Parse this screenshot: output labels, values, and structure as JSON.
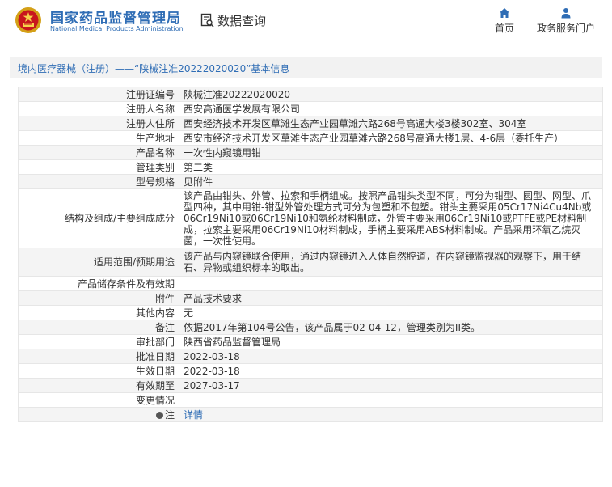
{
  "header": {
    "brand_cn": "国家药品监督管理局",
    "brand_en": "National Medical Products Administration",
    "data_query": "数据查询",
    "nav": [
      {
        "label": "首页",
        "icon": "home-icon"
      },
      {
        "label": "政务服务门户",
        "icon": "user-icon"
      }
    ]
  },
  "section": {
    "title": "境内医疗器械（注册）——“陕械注准20222020020”基本信息"
  },
  "rows": [
    {
      "label": "注册证编号",
      "value": "陕械注准20222020020"
    },
    {
      "label": "注册人名称",
      "value": "西安高通医学发展有限公司"
    },
    {
      "label": "注册人住所",
      "value": "西安经济技术开发区草滩生态产业园草滩六路268号高通大楼3楼302室、304室"
    },
    {
      "label": "生产地址",
      "value": "西安市经济技术开发区草滩生态产业园草滩六路268号高通大楼1层、4-6层（委托生产）"
    },
    {
      "label": "产品名称",
      "value": "一次性内窥镜用钳"
    },
    {
      "label": "管理类别",
      "value": "第二类"
    },
    {
      "label": "型号规格",
      "value": "见附件"
    },
    {
      "label": "结构及组成/主要组成成分",
      "value": "该产品由钳头、外管、拉索和手柄组成。按照产品钳头类型不同，可分为钳型、圆型、网型、爪型四种，其中用钳-钳型外管处理方式可分为包塑和不包塑。钳头主要采用05Cr17Ni4Cu4Nb或06Cr19Ni10或06Cr19Ni10和氨纶材料制成，外管主要采用06Cr19Ni10或PTFE或PE材料制成，拉索主要采用06Cr19Ni10材料制成，手柄主要采用ABS材料制成。产品采用环氧乙烷灭菌，一次性使用。"
    },
    {
      "label": "适用范围/预期用途",
      "value": "该产品与内窥镜联合使用，通过内窥镜进入人体自然腔道，在内窥镜监视器的观察下，用于结石、异物或组织标本的取出。"
    },
    {
      "label": "产品储存条件及有效期",
      "value": ""
    },
    {
      "label": "附件",
      "value": "产品技术要求"
    },
    {
      "label": "其他内容",
      "value": "无"
    },
    {
      "label": "备注",
      "value": "依据2017年第104号公告，该产品属于02-04-12，管理类别为II类。"
    },
    {
      "label": "审批部门",
      "value": "陕西省药品监督管理局"
    },
    {
      "label": "批准日期",
      "value": "2022-03-18"
    },
    {
      "label": "生效日期",
      "value": "2022-03-18"
    },
    {
      "label": "有效期至",
      "value": "2027-03-17"
    },
    {
      "label": "变更情况",
      "value": ""
    },
    {
      "label": "注",
      "value": "详情"
    }
  ]
}
